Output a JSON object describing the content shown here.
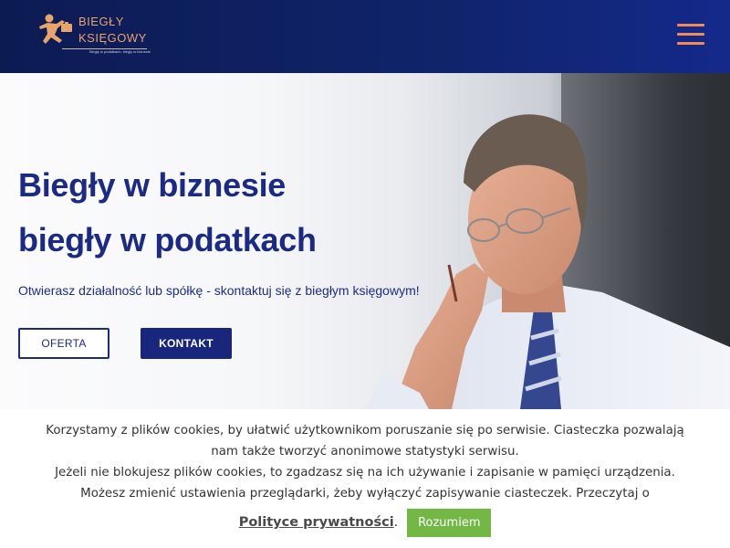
{
  "header": {
    "logo_line1": "BIEGŁY",
    "logo_line2": "KSIĘGOWY",
    "logo_tagline": "Biegły w podatkach, biegły w biznesie",
    "brand_color": "#f08a56"
  },
  "hero": {
    "title_line1": "Biegły w biznesie",
    "title_line2": "biegły w podatkach",
    "subtitle": "Otwierasz działalność lub spółkę - skontaktuj się z biegłym księgowym!",
    "oferta_label": "OFERTA",
    "kontakt_label": "KONTAKT",
    "accent_color": "#1b2a84"
  },
  "cookie": {
    "line1": "Korzystamy z plików cookies, by ułatwić użytkownikom poruszanie się po serwisie. Ciasteczka pozwalają",
    "line2": "nam także tworzyć anonimowe statystyki serwisu.",
    "line3": "Jeżeli nie blokujesz plików cookies, to zgadzasz się na ich używanie i zapisanie w pamięci urządzenia.",
    "line4": "Możesz zmienić ustawienia przeglądarki, żeby wyłączyć zapisywanie ciasteczek. Przeczytaj o",
    "policy_link": "Polityce prywatności",
    "policy_suffix": ".",
    "accept_label": "Rozumiem",
    "accept_color": "#73b845"
  }
}
